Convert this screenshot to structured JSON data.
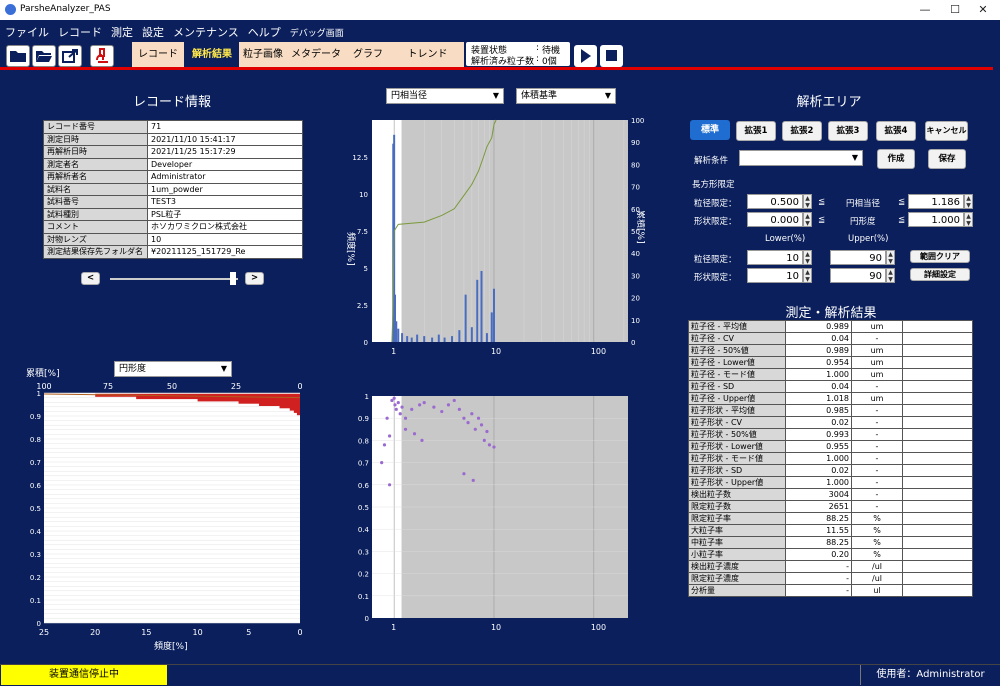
{
  "window": {
    "title": "ParsheAnalyzer_PAS",
    "min": "—",
    "max": "☐",
    "close": "✕"
  },
  "menu": [
    "ファイル",
    "レコード",
    "測定",
    "設定",
    "メンテナンス",
    "ヘルプ",
    "デバッグ画面"
  ],
  "tabs": [
    "レコード",
    "解析結果",
    "粒子画像",
    "メタデータ",
    "グラフ",
    "トレンド"
  ],
  "status": {
    "state_label": "装置状態",
    "state_sep": ":",
    "state_value": "待機",
    "count_label": "解析済み粒子数",
    "count_sep": ":",
    "count_value": "0個"
  },
  "record": {
    "title": "レコード情報",
    "rows": [
      {
        "k": "レコード番号",
        "v": "71"
      },
      {
        "k": "測定日時",
        "v": "2021/11/10 15:41:17"
      },
      {
        "k": "再解析日時",
        "v": "2021/11/25 15:17:29"
      },
      {
        "k": "測定者名",
        "v": "Developer"
      },
      {
        "k": "再解析者名",
        "v": "Administrator"
      },
      {
        "k": "試料名",
        "v": "1um_powder"
      },
      {
        "k": "試料番号",
        "v": "TEST3"
      },
      {
        "k": "試料種別",
        "v": "PSL粒子"
      },
      {
        "k": "コメント",
        "v": "ホソカワミクロン株式会社"
      },
      {
        "k": "対物レンズ",
        "v": "10"
      },
      {
        "k": "測定結果保存先フォルダ名",
        "v": "¥20211125_151729_Re"
      }
    ],
    "prev": "<",
    "next": ">"
  },
  "hist": {
    "select_x": "円相当径",
    "select_basis": "体積基準"
  },
  "cum": {
    "select": "円形度",
    "ylabel": "累積[%]",
    "xlabel": "頻度[%]"
  },
  "area": {
    "title": "解析エリア",
    "modes": [
      "標準",
      "拡張1",
      "拡張2",
      "拡張3",
      "拡張4",
      "キャンセル"
    ],
    "cond_label": "解析条件",
    "cond_value": "",
    "create": "作成",
    "save": "保存",
    "rect_label": "長方形限定",
    "size_lim": "粒径限定：",
    "shape_lim": "形状限定：",
    "size_lo": "0.500",
    "size_hi": "1.186",
    "shape_lo": "0.000",
    "shape_hi": "1.000",
    "le": "≦",
    "diam": "円相当径",
    "circ": "円形度",
    "lower": "Lower(%)",
    "upper": "Upper(%)",
    "size_lower": "10",
    "size_upper": "90",
    "shape_lower": "10",
    "shape_upper": "90",
    "clear": "範囲クリア",
    "detail": "詳細設定"
  },
  "results": {
    "title": "測定・解析結果",
    "rows": [
      {
        "k": "粒子径 - 平均値",
        "v": "0.989",
        "u": "um"
      },
      {
        "k": "粒子径 - CV",
        "v": "0.04",
        "u": "-"
      },
      {
        "k": "粒子径 - 50%値",
        "v": "0.989",
        "u": "um"
      },
      {
        "k": "粒子径 - Lower値",
        "v": "0.954",
        "u": "um"
      },
      {
        "k": "粒子径 - モード値",
        "v": "1.000",
        "u": "um"
      },
      {
        "k": "粒子径 - SD",
        "v": "0.04",
        "u": "-"
      },
      {
        "k": "粒子径 - Upper値",
        "v": "1.018",
        "u": "um"
      },
      {
        "k": "粒子形状 - 平均値",
        "v": "0.985",
        "u": "-"
      },
      {
        "k": "粒子形状 - CV",
        "v": "0.02",
        "u": "-"
      },
      {
        "k": "粒子形状 - 50%値",
        "v": "0.993",
        "u": "-"
      },
      {
        "k": "粒子形状 - Lower値",
        "v": "0.955",
        "u": "-"
      },
      {
        "k": "粒子形状 - モード値",
        "v": "1.000",
        "u": "-"
      },
      {
        "k": "粒子形状 - SD",
        "v": "0.02",
        "u": "-"
      },
      {
        "k": "粒子形状 - Upper値",
        "v": "1.000",
        "u": "-"
      },
      {
        "k": "検出粒子数",
        "v": "3004",
        "u": "-"
      },
      {
        "k": "限定粒子数",
        "v": "2651",
        "u": "-"
      },
      {
        "k": "限定粒子率",
        "v": "88.25",
        "u": "%"
      },
      {
        "k": "大粒子率",
        "v": "11.55",
        "u": "%"
      },
      {
        "k": "中粒子率",
        "v": "88.25",
        "u": "%"
      },
      {
        "k": "小粒子率",
        "v": "0.20",
        "u": "%"
      },
      {
        "k": "検出粒子濃度",
        "v": "-",
        "u": "/ul"
      },
      {
        "k": "限定粒子濃度",
        "v": "-",
        "u": "/ul"
      },
      {
        "k": "分析量",
        "v": "-",
        "u": "ul"
      }
    ]
  },
  "footer": {
    "comm": "装置通信停止中",
    "user": "使用者：Administrator"
  },
  "chart_data": [
    {
      "type": "bar",
      "name": "histogram",
      "xscale": "log",
      "xlim": [
        0.6,
        220
      ],
      "ylim": [
        0,
        15
      ],
      "y2lim": [
        0,
        100
      ],
      "xticks": [
        "1",
        "10",
        "100"
      ],
      "yticks": [
        "0",
        "2.5",
        "5",
        "7.5",
        "10",
        "12.5"
      ],
      "y2ticks": [
        "0",
        "10",
        "20",
        "30",
        "40",
        "50",
        "60",
        "70",
        "80",
        "90",
        "100"
      ],
      "ylabel": "頻度[%]",
      "y2label": "累積[%]",
      "bars": [
        [
          0.98,
          13.4
        ],
        [
          1.0,
          14.0
        ],
        [
          1.02,
          3.2
        ],
        [
          1.05,
          1.4
        ],
        [
          1.1,
          0.9
        ],
        [
          1.2,
          0.6
        ],
        [
          1.35,
          0.4
        ],
        [
          1.5,
          0.3
        ],
        [
          1.7,
          0.5
        ],
        [
          2.0,
          0.4
        ],
        [
          2.4,
          0.3
        ],
        [
          2.8,
          0.5
        ],
        [
          3.2,
          0.3
        ],
        [
          3.8,
          0.4
        ],
        [
          4.5,
          0.8
        ],
        [
          5.2,
          3.2
        ],
        [
          6.0,
          1.0
        ],
        [
          6.8,
          4.2
        ],
        [
          7.5,
          4.8
        ],
        [
          8.5,
          0.6
        ],
        [
          9.5,
          2.0
        ],
        [
          10.0,
          3.6
        ]
      ],
      "cumulative": [
        [
          0.95,
          0
        ],
        [
          0.97,
          12
        ],
        [
          1.0,
          50
        ],
        [
          1.1,
          53
        ],
        [
          2,
          54
        ],
        [
          3,
          57
        ],
        [
          4,
          60
        ],
        [
          5,
          66
        ],
        [
          6,
          71
        ],
        [
          7,
          77
        ],
        [
          7.8,
          83
        ],
        [
          8.5,
          88
        ],
        [
          9.5,
          92
        ],
        [
          10,
          98
        ],
        [
          10.5,
          100
        ]
      ]
    },
    {
      "type": "bar",
      "name": "cumulative-circularity",
      "x_reversed": true,
      "xlim": [
        0,
        100
      ],
      "ylim": [
        0,
        1
      ],
      "xticks": [
        "100",
        "75",
        "50",
        "25",
        "0"
      ],
      "x2ticks": [
        "25",
        "20",
        "15",
        "10",
        "5",
        "0"
      ],
      "yticks": [
        "0",
        "0.1",
        "0.2",
        "0.3",
        "0.4",
        "0.5",
        "0.6",
        "0.7",
        "0.8",
        "0.9",
        "1"
      ],
      "bars": [
        [
          0.99,
          20
        ],
        [
          0.98,
          16
        ],
        [
          0.97,
          10
        ],
        [
          0.96,
          6
        ],
        [
          0.95,
          4
        ],
        [
          0.94,
          2
        ],
        [
          0.93,
          1
        ],
        [
          0.92,
          0.6
        ],
        [
          0.91,
          0.3
        ]
      ]
    },
    {
      "type": "scatter",
      "name": "diameter-vs-circularity",
      "xscale": "log",
      "xlim": [
        0.6,
        220
      ],
      "ylim": [
        0,
        1
      ],
      "xticks": [
        "1",
        "10",
        "100"
      ],
      "yticks": [
        "0",
        "0.1",
        "0.2",
        "0.3",
        "0.4",
        "0.5",
        "0.6",
        "0.7",
        "0.8",
        "0.9",
        "1"
      ],
      "points": [
        [
          0.95,
          0.98
        ],
        [
          1.0,
          0.99
        ],
        [
          1.02,
          0.96
        ],
        [
          1.05,
          0.94
        ],
        [
          1.1,
          0.97
        ],
        [
          1.15,
          0.92
        ],
        [
          1.2,
          0.95
        ],
        [
          1.3,
          0.9
        ],
        [
          1.5,
          0.94
        ],
        [
          1.8,
          0.96
        ],
        [
          2.0,
          0.97
        ],
        [
          2.5,
          0.95
        ],
        [
          3.0,
          0.93
        ],
        [
          3.5,
          0.96
        ],
        [
          4.0,
          0.98
        ],
        [
          4.5,
          0.94
        ],
        [
          5.0,
          0.9
        ],
        [
          5.5,
          0.88
        ],
        [
          6.0,
          0.92
        ],
        [
          6.5,
          0.85
        ],
        [
          7.0,
          0.9
        ],
        [
          7.5,
          0.87
        ],
        [
          8.0,
          0.8
        ],
        [
          9.0,
          0.78
        ],
        [
          10.0,
          0.77
        ],
        [
          0.9,
          0.82
        ],
        [
          0.85,
          0.9
        ],
        [
          0.75,
          0.7
        ],
        [
          0.8,
          0.78
        ],
        [
          1.3,
          0.85
        ],
        [
          1.6,
          0.83
        ],
        [
          1.9,
          0.8
        ],
        [
          5.0,
          0.65
        ],
        [
          6.2,
          0.62
        ],
        [
          8.5,
          0.84
        ],
        [
          0.9,
          0.6
        ]
      ]
    }
  ]
}
